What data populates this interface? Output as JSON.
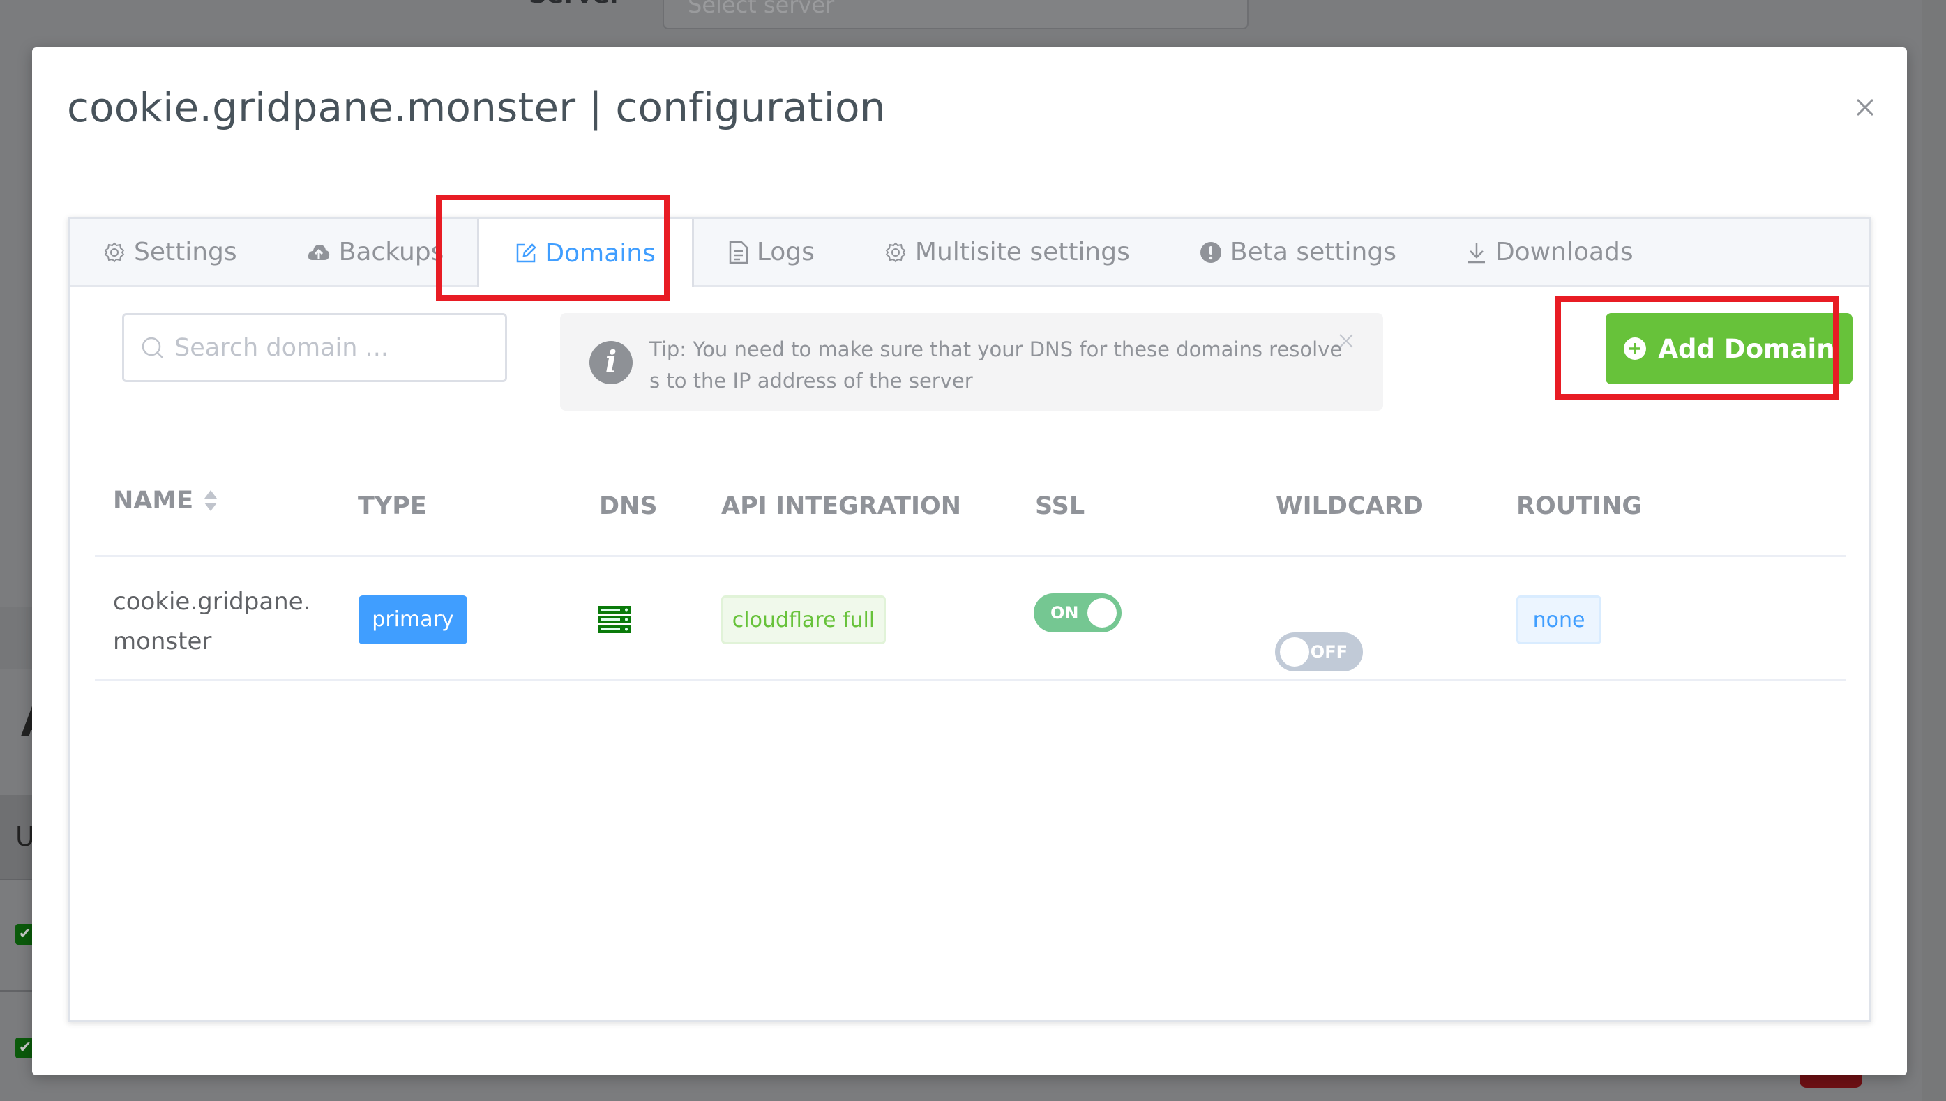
{
  "background": {
    "server_label": "Server",
    "server_select_placeholder": "Select server",
    "heading_fragment": "A",
    "column_fragment": "U"
  },
  "modal": {
    "title": "cookie.gridpane.monster | configuration",
    "close_icon": "close-icon"
  },
  "tabs": [
    {
      "label": "Settings",
      "icon": "gear-icon",
      "active": false
    },
    {
      "label": "Backups",
      "icon": "cloud-upload-icon",
      "active": false
    },
    {
      "label": "Domains",
      "icon": "edit-icon",
      "active": true
    },
    {
      "label": "Logs",
      "icon": "document-icon",
      "active": false
    },
    {
      "label": "Multisite settings",
      "icon": "gear-icon",
      "active": false
    },
    {
      "label": "Beta settings",
      "icon": "warning-circle-icon",
      "active": false
    },
    {
      "label": "Downloads",
      "icon": "download-icon",
      "active": false
    }
  ],
  "search": {
    "placeholder": "Search domain ...",
    "value": ""
  },
  "tip": {
    "text": "Tip: You need to make sure that your DNS for these domains resolves to the IP address of the server"
  },
  "add_domain_button": {
    "label": "Add Domain"
  },
  "table": {
    "columns": [
      "NAME",
      "TYPE",
      "DNS",
      "API INTEGRATION",
      "SSL",
      "WILDCARD",
      "ROUTING"
    ],
    "rows": [
      {
        "name": "cookie.gridpane.monster",
        "type": "primary",
        "dns_icon": "server-icon",
        "api_integration": "cloudflare full",
        "ssl": "ON",
        "wildcard": "OFF",
        "routing": "none"
      }
    ]
  },
  "colors": {
    "accent_blue": "#409eff",
    "success_green": "#67c23a",
    "switch_on": "#75c792",
    "switch_off": "#c1cad7",
    "annotation_red": "#e81c24"
  }
}
